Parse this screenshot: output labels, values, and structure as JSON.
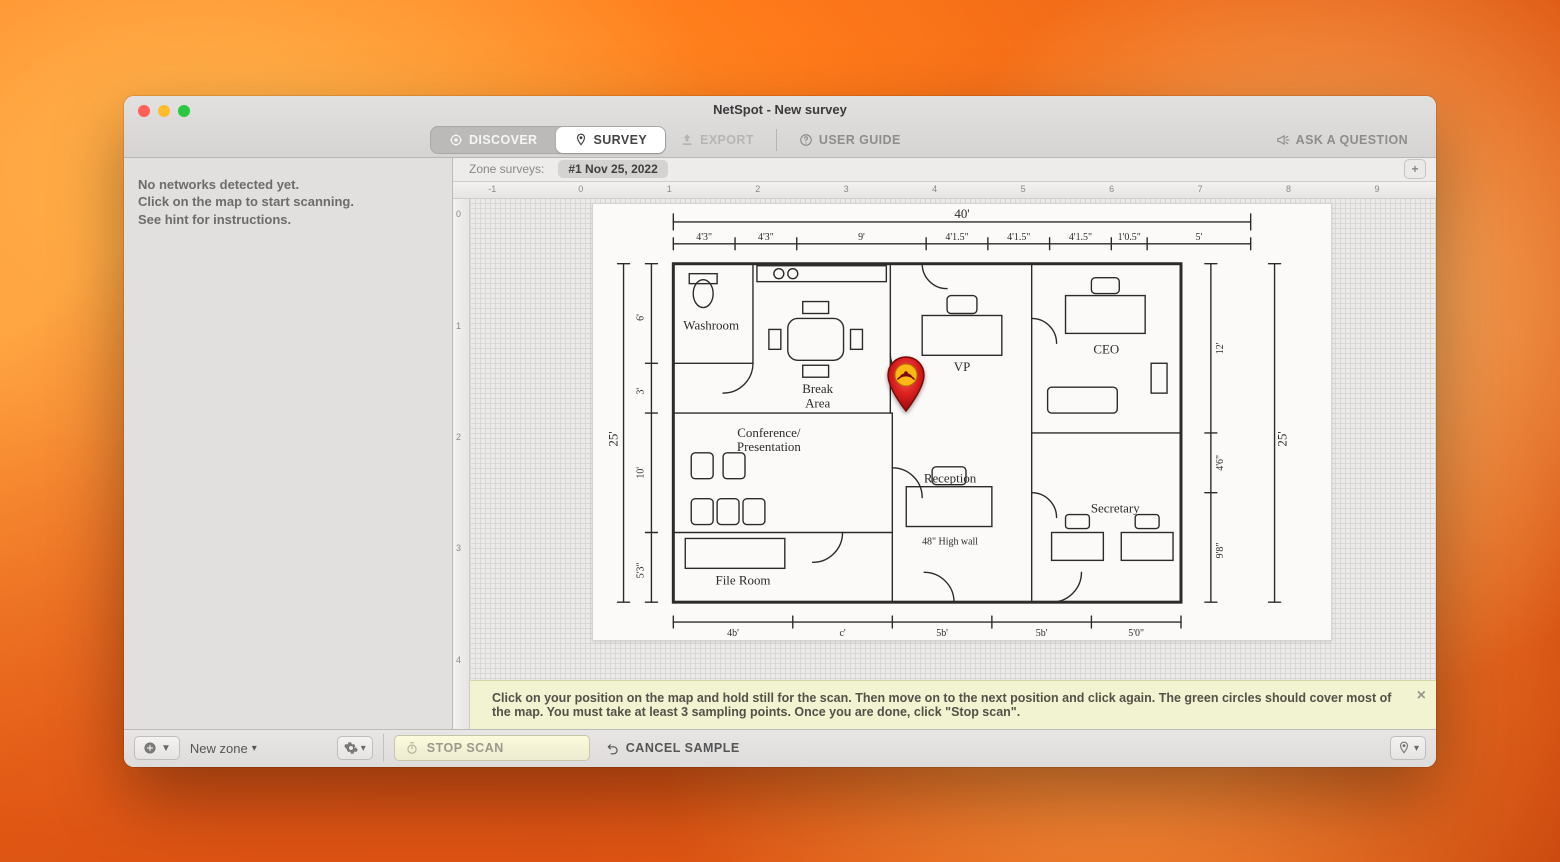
{
  "window_title": "NetSpot - New survey",
  "tabs": {
    "discover": "DISCOVER",
    "survey": "SURVEY"
  },
  "toolbar": {
    "export": "EXPORT",
    "user_guide": "USER GUIDE",
    "ask": "ASK A QUESTION"
  },
  "sidebar": {
    "line1": "No networks detected yet.",
    "line2": "Click on the map to start scanning.",
    "line3": "See hint for instructions."
  },
  "zonebar": {
    "label": "Zone surveys:",
    "chip": "#1 Nov 25, 2022"
  },
  "ruler_h": [
    "-1",
    "0",
    "1",
    "2",
    "3",
    "4",
    "5",
    "6",
    "7",
    "8",
    "9"
  ],
  "ruler_v": [
    "0",
    "1",
    "2",
    "3",
    "4"
  ],
  "hint": "Click on your position on the map and hold still for the scan. Then move on to the next position and click again. The green circles should cover most of the map. You must take at least 3 sampling points. Once you are done, click \"Stop scan\".",
  "footer": {
    "new_zone": "New zone",
    "stop_scan": "STOP SCAN",
    "cancel_sample": "CANCEL SAMPLE"
  },
  "plan": {
    "width_label": "40'",
    "height_label_left": "25'",
    "height_label_right": "25'",
    "rooms": {
      "washroom": "Washroom",
      "break": "Break\nArea",
      "conference": "Conference/\nPresentation",
      "file": "File Room",
      "vp": "VP",
      "ceo": "CEO",
      "reception": "Reception",
      "secretary": "Secretary"
    },
    "notes": {
      "reception_wall": "48\" High wall"
    },
    "top_dims": [
      "4'3\"",
      "4'3\"",
      "9'",
      "4'1.5\"",
      "4'1.5\"",
      "4'1.5\"",
      "1'0.5\"",
      "5'"
    ],
    "bottom_dims": [
      "4b'",
      "c'",
      "5b'",
      "5b'",
      "5'0\""
    ],
    "left_dims": [
      "6'",
      "10'",
      "3'",
      "5'3\""
    ],
    "right_dims": [
      "12'",
      "4'6\"",
      "9'8\""
    ]
  }
}
